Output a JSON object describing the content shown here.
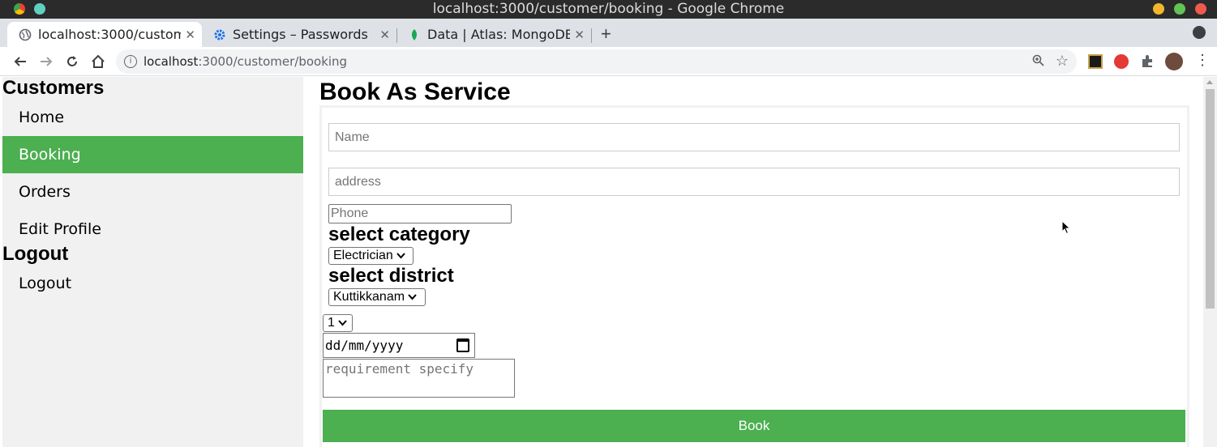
{
  "window": {
    "title": "localhost:3000/customer/booking - Google Chrome"
  },
  "tabs": [
    {
      "label": "localhost:3000/custom",
      "icon": "globe-icon",
      "active": true,
      "close": "✕"
    },
    {
      "label": "Settings – Passwords",
      "icon": "gear-icon",
      "active": false,
      "close": "✕"
    },
    {
      "label": "Data | Atlas: MongoDB",
      "icon": "leaf-icon",
      "active": false,
      "close": "✕"
    }
  ],
  "new_tab": "+",
  "address": {
    "host": "localhost",
    "path": ":3000/customer/booking"
  },
  "sidebar": {
    "heading_customers": "Customers",
    "items": [
      {
        "label": "Home"
      },
      {
        "label": "Booking"
      },
      {
        "label": "Orders"
      },
      {
        "label": "Edit Profile"
      }
    ],
    "heading_logout": "Logout",
    "logout_item": "Logout"
  },
  "form": {
    "title": "Book As Service",
    "name_placeholder": "Name",
    "address_placeholder": "address",
    "phone_placeholder": "Phone",
    "category_label": "select category",
    "category_value": "Electrician",
    "district_label": "select district",
    "district_value": "Kuttikkanam",
    "quantity_value": "1",
    "date_placeholder": "dd/mm/yyyy",
    "requirement_placeholder": "requirement specify",
    "submit_label": "Book"
  },
  "colors": {
    "accent": "#4caf50",
    "sidebar_bg": "#f1f1f1"
  }
}
